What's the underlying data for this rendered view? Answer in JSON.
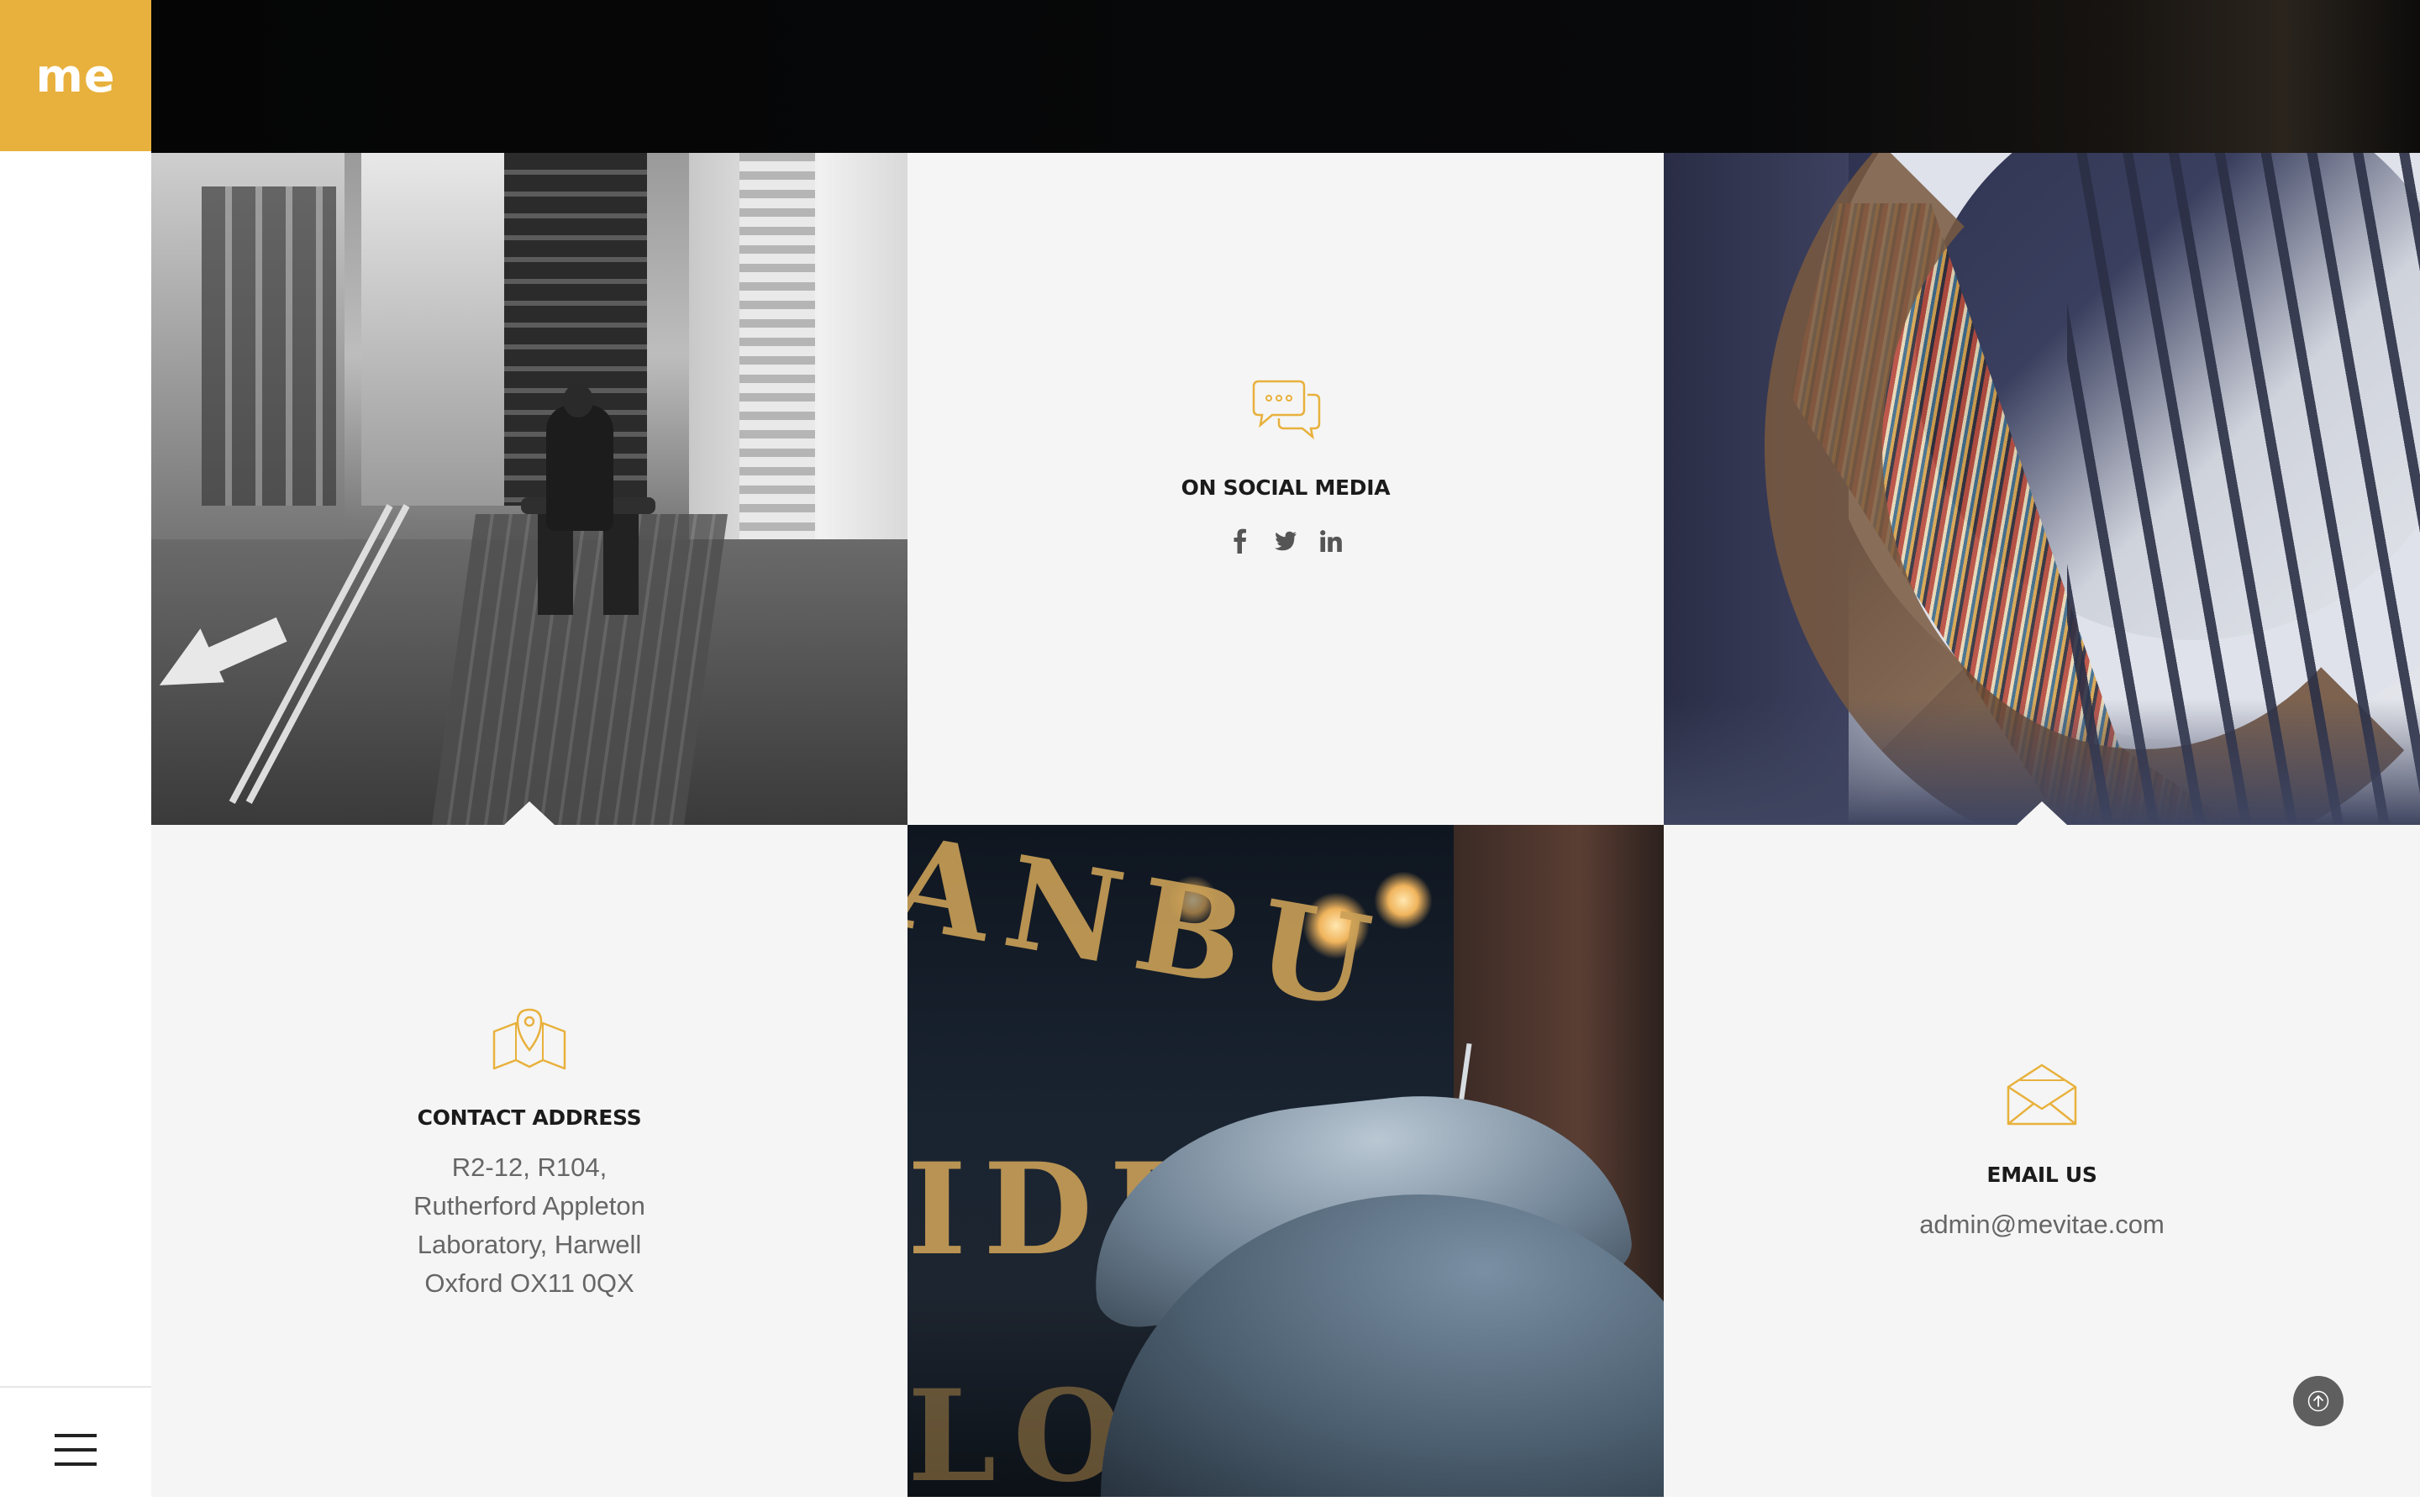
{
  "brand": {
    "logo_text": "me",
    "accent_color": "#e8b13d"
  },
  "social": {
    "title": "ON SOCIAL MEDIA",
    "icon": "chat-bubbles-icon",
    "links": [
      {
        "label": "f",
        "icon": "facebook-icon"
      },
      {
        "label": "twitter",
        "icon": "twitter-icon"
      },
      {
        "label": "in",
        "icon": "linkedin-icon"
      }
    ]
  },
  "address": {
    "title": "CONTACT ADDRESS",
    "icon": "map-pin-icon",
    "lines": [
      "R2-12, R104,",
      "Rutherford Appleton",
      "Laboratory, Harwell",
      "Oxford OX11 0QX"
    ]
  },
  "email": {
    "title": "EMAIL US",
    "icon": "envelope-icon",
    "value": "admin@mevitae.com"
  },
  "photos": {
    "street": "street-photo",
    "library": "library-photo",
    "umbrella": "umbrella-photo",
    "umbrella_sign_text": [
      "ANBU",
      "IDE",
      "LON"
    ]
  },
  "controls": {
    "menu_icon": "hamburger-icon",
    "back_to_top_icon": "arrow-up-icon"
  }
}
